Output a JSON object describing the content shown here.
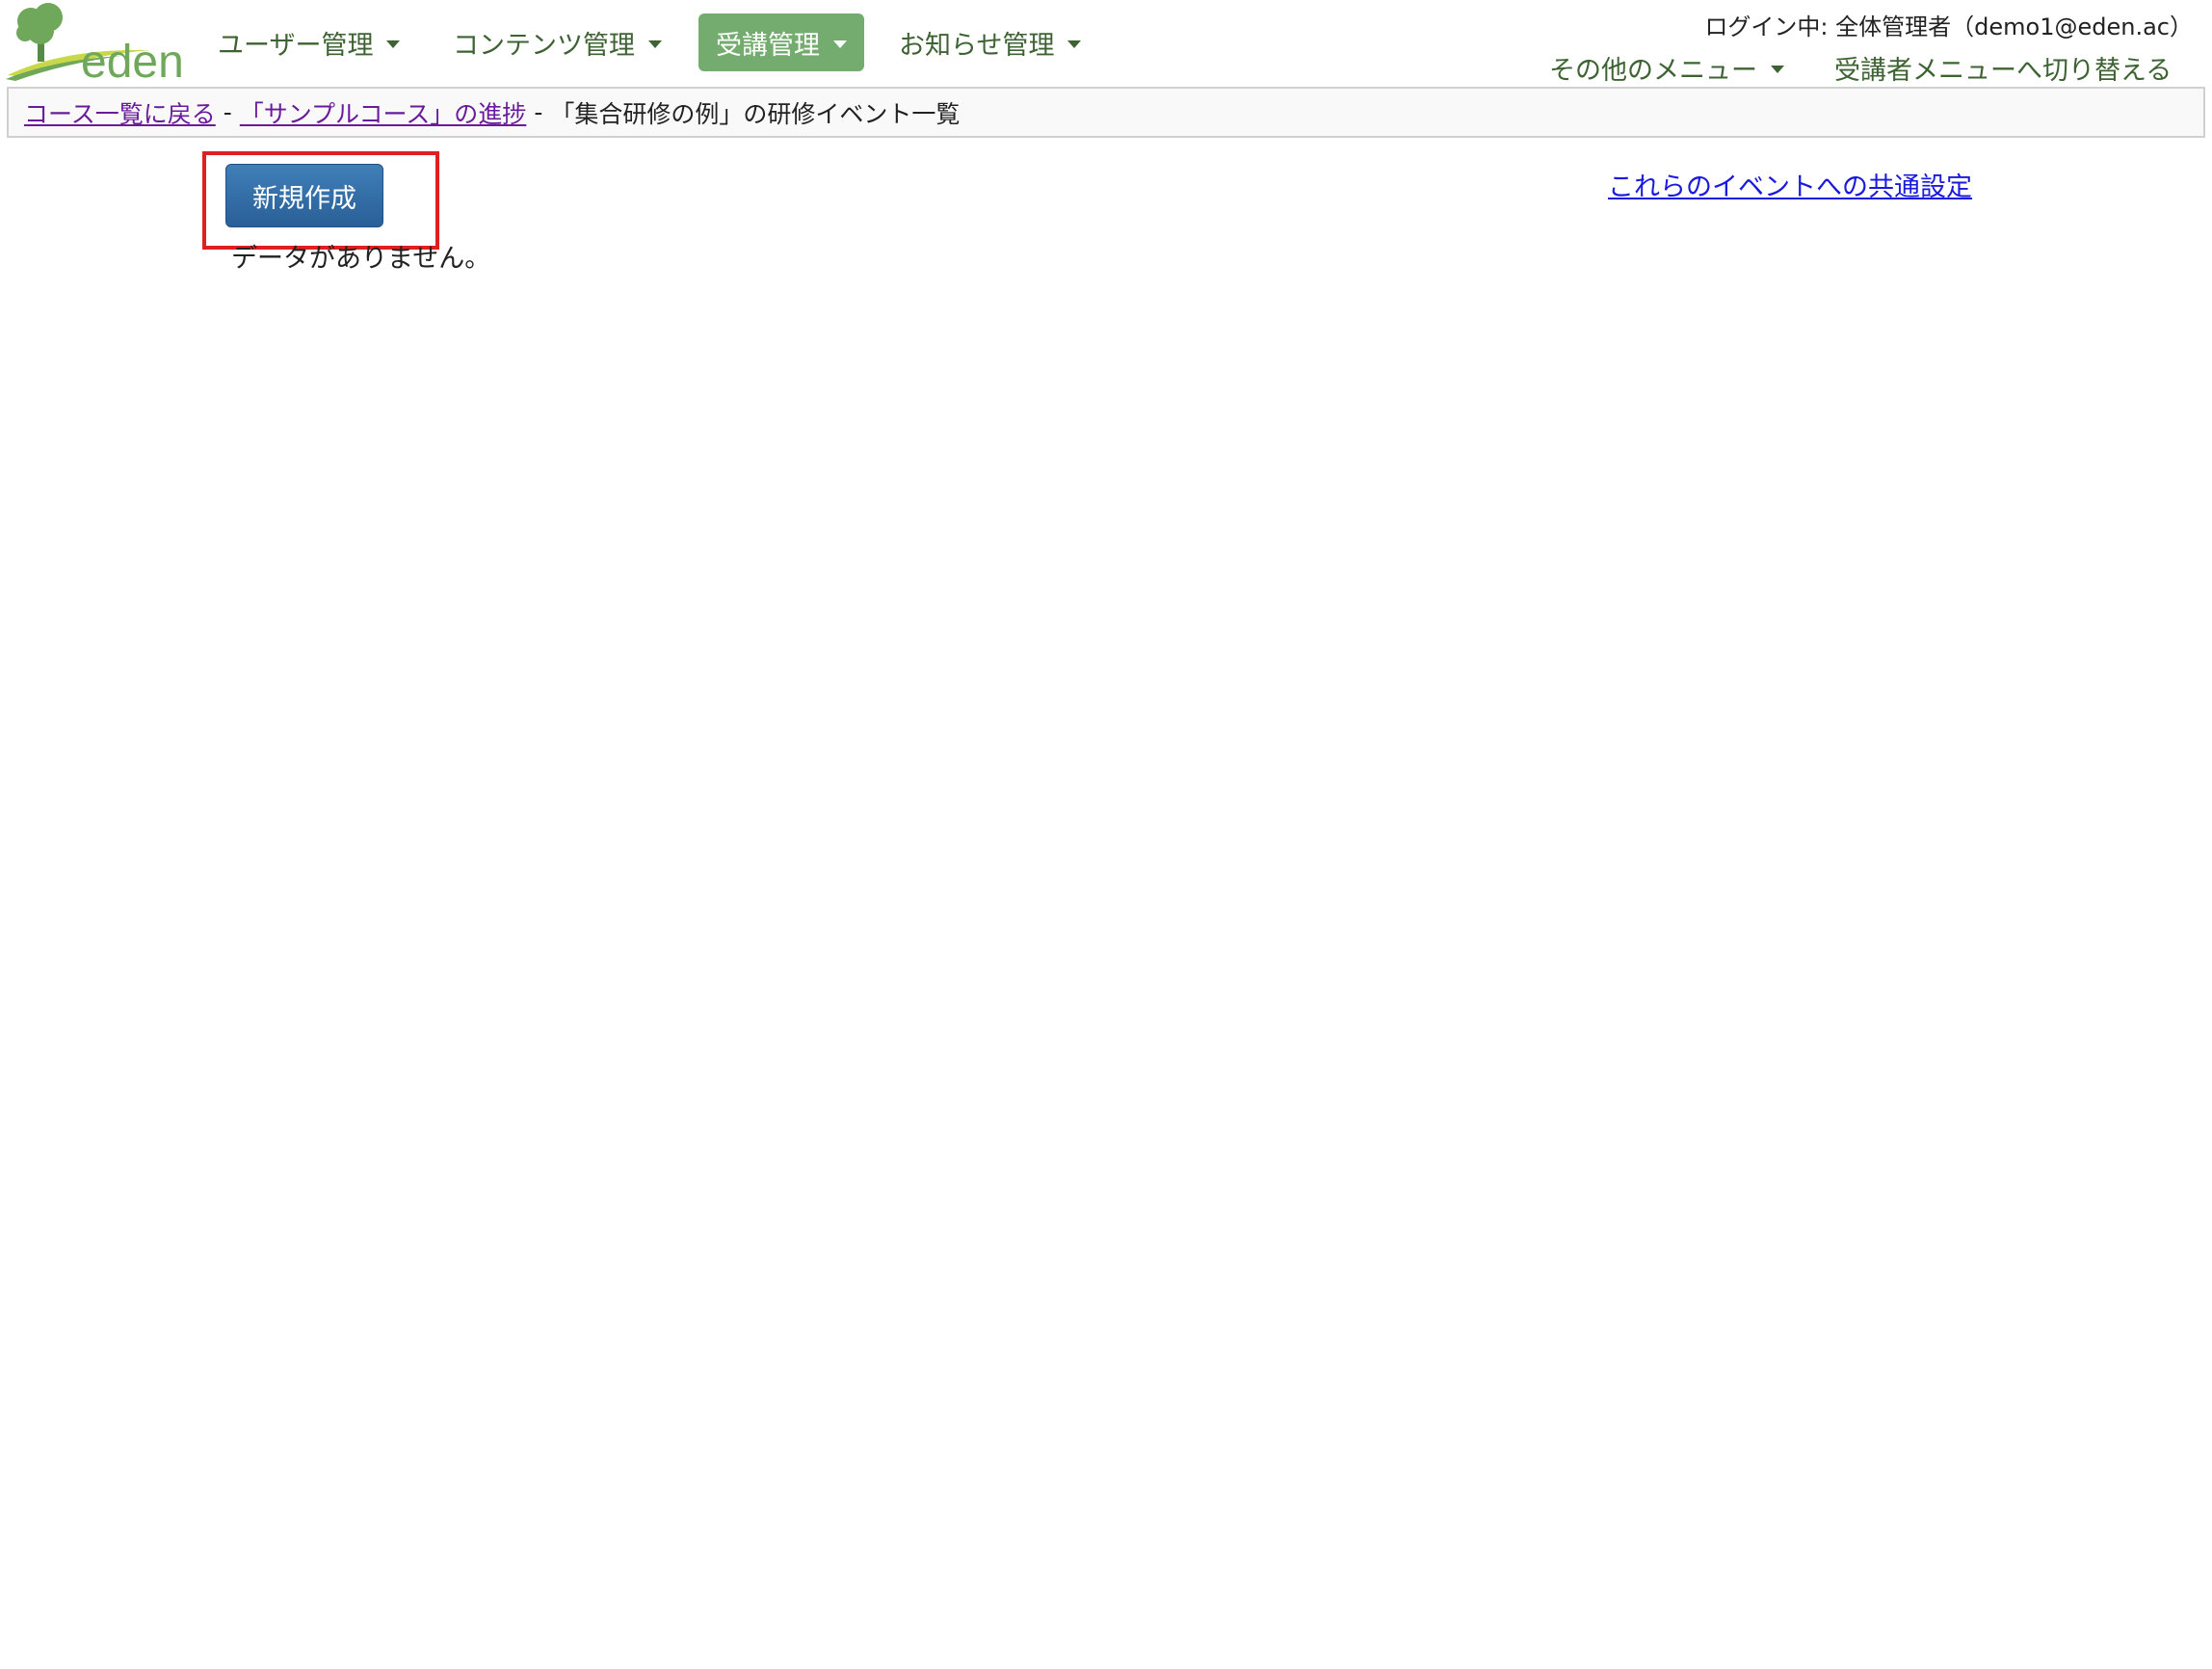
{
  "brand": {
    "logo_text": "eden",
    "colors": {
      "green": "#6fa85a",
      "yellow": "#c8d84a"
    }
  },
  "nav": {
    "items": [
      {
        "label": "ユーザー管理",
        "active": false
      },
      {
        "label": "コンテンツ管理",
        "active": false
      },
      {
        "label": "受講管理",
        "active": true
      },
      {
        "label": "お知らせ管理",
        "active": false
      }
    ]
  },
  "header": {
    "login_status": "ログイン中: 全体管理者（demo1@eden.ac）",
    "other_menu": "その他のメニュー",
    "switch_menu": "受講者メニューへ切り替える"
  },
  "breadcrumb": {
    "back_to_courses": "コース一覧に戻る",
    "course_progress": "「サンプルコース」の進捗",
    "current_page": "「集合研修の例」の研修イベント一覧",
    "separator": "-"
  },
  "main": {
    "new_button_label": "新規作成",
    "common_settings_link": "これらのイベントへの共通設定",
    "empty_message": "データがありません。"
  },
  "colors": {
    "nav_text": "#3e6332",
    "nav_active_bg": "#74ac6f",
    "button_blue": "#2f6aa4",
    "highlight_red": "#e02020",
    "link_blue": "#1a1adf",
    "visited_link": "#6a1b9a"
  }
}
